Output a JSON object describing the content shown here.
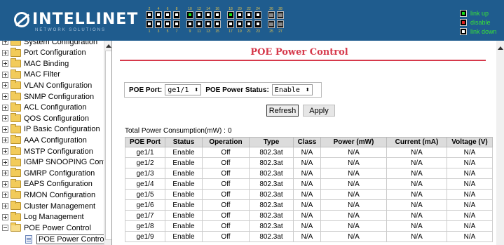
{
  "header": {
    "logo_text": "INTELLINET",
    "logo_subtitle": "NETWORK SOLUTIONS",
    "ports_top": [
      "2",
      "4",
      "6",
      "8",
      "10",
      "12",
      "14",
      "16",
      "18",
      "20",
      "22",
      "24",
      "26",
      "28"
    ],
    "ports_bottom": [
      "1",
      "3",
      "5",
      "7",
      "9",
      "11",
      "13",
      "15",
      "17",
      "19",
      "21",
      "23",
      "25",
      "27"
    ],
    "legend": {
      "up": "link up",
      "disable": "disable",
      "down": "link down"
    }
  },
  "sidebar": {
    "items": [
      {
        "label": "System Configuration"
      },
      {
        "label": "Port Configuration"
      },
      {
        "label": "MAC Binding"
      },
      {
        "label": "MAC Filter"
      },
      {
        "label": "VLAN Configuration"
      },
      {
        "label": "SNMP Configuration"
      },
      {
        "label": "ACL Configuration"
      },
      {
        "label": "QOS Configuration"
      },
      {
        "label": "IP Basic Configuration"
      },
      {
        "label": "AAA Configuration"
      },
      {
        "label": "MSTP Configuration"
      },
      {
        "label": "IGMP SNOOPING Config"
      },
      {
        "label": "GMRP Configuration"
      },
      {
        "label": "EAPS Configuration"
      },
      {
        "label": "RMON Configuration"
      },
      {
        "label": "Cluster Management"
      },
      {
        "label": "Log Management"
      },
      {
        "label": "POE Power Control"
      }
    ],
    "child": "POE Power Control"
  },
  "main": {
    "title": "POE Power Control",
    "poe_port_label": "POE Port:",
    "poe_port_value": "ge1/1",
    "poe_status_label": "POE Power Status:",
    "poe_status_value": "Enable",
    "refresh_label": "Refresh",
    "apply_label": "Apply",
    "total_label": "Total Power Consumption(mW) :",
    "total_value": "0",
    "table": {
      "headers": [
        "POE Port",
        "Status",
        "Operation",
        "Type",
        "Class",
        "Power (mW)",
        "Current (mA)",
        "Voltage (V)"
      ],
      "rows": [
        [
          "ge1/1",
          "Enable",
          "Off",
          "802.3at",
          "N/A",
          "N/A",
          "N/A",
          "N/A"
        ],
        [
          "ge1/2",
          "Enable",
          "Off",
          "802.3at",
          "N/A",
          "N/A",
          "N/A",
          "N/A"
        ],
        [
          "ge1/3",
          "Enable",
          "Off",
          "802.3at",
          "N/A",
          "N/A",
          "N/A",
          "N/A"
        ],
        [
          "ge1/4",
          "Enable",
          "Off",
          "802.3at",
          "N/A",
          "N/A",
          "N/A",
          "N/A"
        ],
        [
          "ge1/5",
          "Enable",
          "Off",
          "802.3at",
          "N/A",
          "N/A",
          "N/A",
          "N/A"
        ],
        [
          "ge1/6",
          "Enable",
          "Off",
          "802.3at",
          "N/A",
          "N/A",
          "N/A",
          "N/A"
        ],
        [
          "ge1/7",
          "Enable",
          "Off",
          "802.3at",
          "N/A",
          "N/A",
          "N/A",
          "N/A"
        ],
        [
          "ge1/8",
          "Enable",
          "Off",
          "802.3at",
          "N/A",
          "N/A",
          "N/A",
          "N/A"
        ],
        [
          "ge1/9",
          "Enable",
          "Off",
          "802.3at",
          "N/A",
          "N/A",
          "N/A",
          "N/A"
        ]
      ]
    }
  },
  "colors": {
    "header_bg": "#1f5c8e",
    "title_red": "#d6394b",
    "legend_green": "#38e038"
  }
}
